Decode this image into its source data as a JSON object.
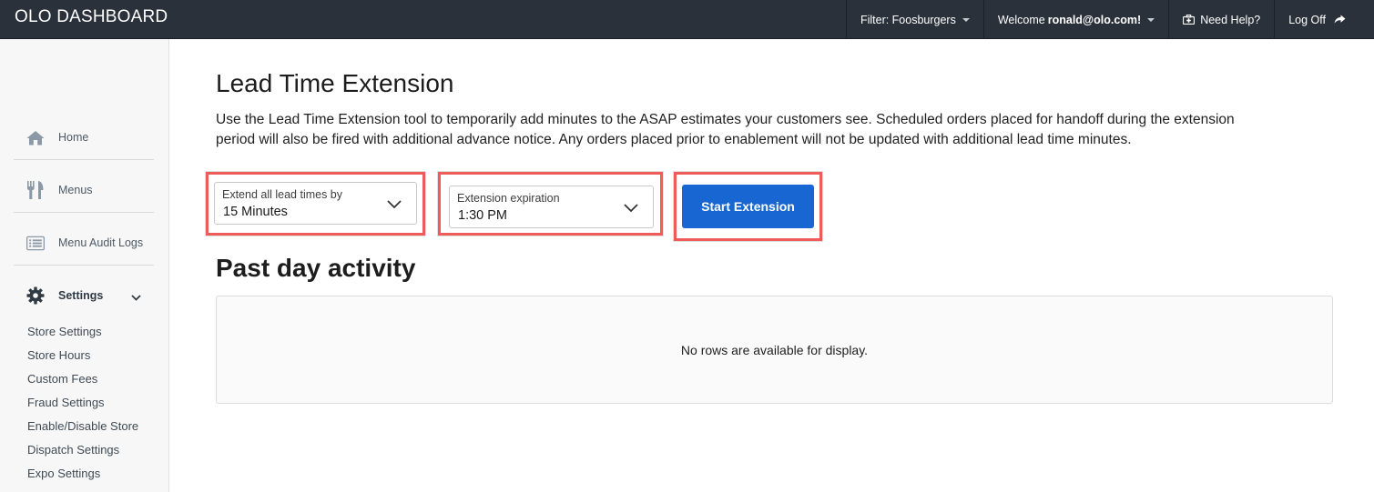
{
  "header": {
    "brand": "OLO DASHBOARD",
    "filter_label": "Filter: Foosburgers",
    "welcome_prefix": "Welcome",
    "welcome_user": "ronald@olo.com!",
    "help_label": "Need Help?",
    "logoff_label": "Log Off",
    "background": "#2b313a"
  },
  "sidebar": {
    "items": [
      {
        "label": "Home",
        "icon": "home-icon"
      },
      {
        "label": "Menus",
        "icon": "utensils-icon"
      },
      {
        "label": "Menu Audit Logs",
        "icon": "list-icon"
      },
      {
        "label": "Settings",
        "icon": "gear-icon"
      }
    ],
    "settings_subitems": [
      "Store Settings",
      "Store Hours",
      "Custom Fees",
      "Fraud Settings",
      "Enable/Disable Store",
      "Dispatch Settings",
      "Expo Settings"
    ]
  },
  "main": {
    "title": "Lead Time Extension",
    "description": "Use the Lead Time Extension tool to temporarily add minutes to the ASAP estimates your customers see. Scheduled orders placed for handoff during the extension period will also be fired with additional advance notice. Any orders placed prior to enablement will not be updated with additional lead time minutes.",
    "extend_select": {
      "label": "Extend all lead times by",
      "value": "15 Minutes"
    },
    "expiration_select": {
      "label": "Extension expiration",
      "value": "1:30 PM"
    },
    "start_button": "Start Extension",
    "activity_title": "Past day activity",
    "empty_message": "No rows are available for display."
  },
  "colors": {
    "accent": "#1766d1",
    "highlight": "#ef5a5a",
    "topbar": "#2b313a"
  }
}
